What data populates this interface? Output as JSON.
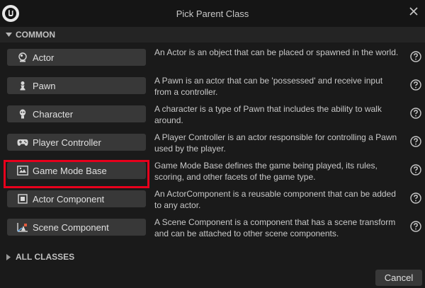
{
  "window": {
    "title": "Pick Parent Class",
    "logo_icon": "unreal-engine-logo-icon",
    "close_icon": "close-icon"
  },
  "sections": {
    "common": {
      "label": "COMMON",
      "expanded": true
    },
    "all_classes": {
      "label": "ALL CLASSES",
      "expanded": false
    }
  },
  "classes": [
    {
      "label": "Actor",
      "icon": "actor-sphere-icon",
      "description": "An Actor is an object that can be placed or spawned in the world."
    },
    {
      "label": "Pawn",
      "icon": "pawn-icon",
      "description": "A Pawn is an actor that can be 'possessed' and receive input from a controller."
    },
    {
      "label": "Character",
      "icon": "character-icon",
      "description": "A character is a type of Pawn that includes the ability to walk around."
    },
    {
      "label": "Player Controller",
      "icon": "gamepad-icon",
      "description": "A Player Controller is an actor responsible for controlling a Pawn used by the player."
    },
    {
      "label": "Game Mode Base",
      "icon": "game-mode-icon",
      "description": "Game Mode Base defines the game being played, its rules, scoring, and other facets of the game type.",
      "highlighted": true
    },
    {
      "label": "Actor Component",
      "icon": "actor-component-icon",
      "description": "An ActorComponent is a reusable component that can be added to any actor."
    },
    {
      "label": "Scene Component",
      "icon": "scene-component-icon",
      "description": "A Scene Component is a component that has a scene transform and can be attached to other scene components."
    }
  ],
  "footer": {
    "cancel_label": "Cancel"
  },
  "colors": {
    "highlight": "#e8001c",
    "background": "#1a1a1a",
    "button": "#383838"
  }
}
